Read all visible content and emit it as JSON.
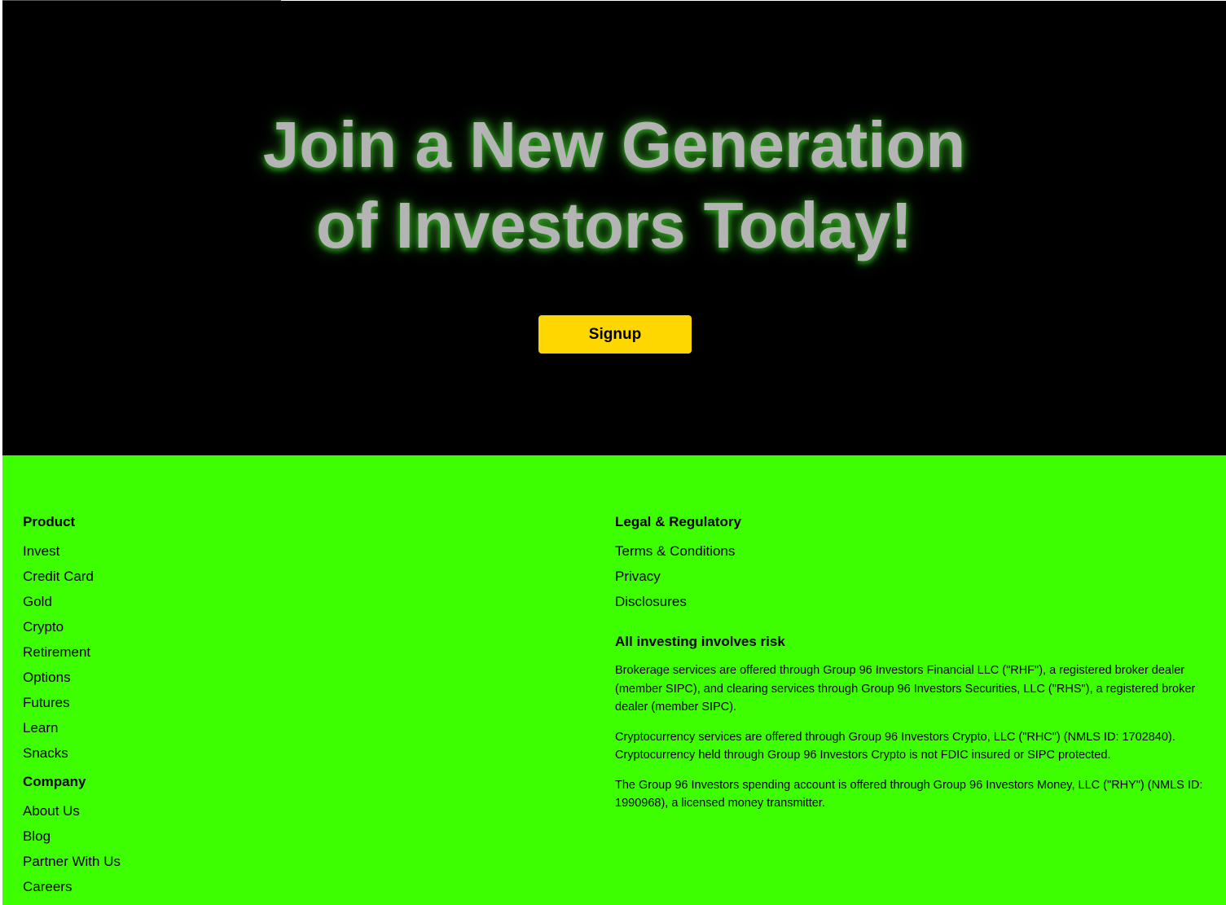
{
  "hero": {
    "title_line1": "Join a New Generation",
    "title_line2": "of Investors Today!",
    "signup_label": "Signup"
  },
  "colors": {
    "hero_background": "#000000",
    "footer_background": "#3dff00",
    "button_background": "#ffd700",
    "title_color": "#b4b4b4"
  },
  "footer": {
    "product": {
      "heading": "Product",
      "links": [
        "Invest",
        "Credit Card",
        "Gold",
        "Crypto",
        "Retirement",
        "Options",
        "Futures",
        "Learn",
        "Snacks"
      ]
    },
    "company": {
      "heading": "Company",
      "links": [
        "About Us",
        "Blog",
        "Partner With Us",
        "Careers"
      ]
    },
    "legal": {
      "heading": "Legal & Regulatory",
      "links": [
        "Terms & Conditions",
        "Privacy",
        "Disclosures"
      ]
    },
    "risk": {
      "heading": "All investing involves risk",
      "paragraphs": [
        "Brokerage services are offered through Group 96 Investors Financial LLC (\"RHF\"), a registered broker dealer (member SIPC), and clearing services through Group 96 Investors Securities, LLC (\"RHS\"), a registered broker dealer (member SIPC).",
        "Cryptocurrency services are offered through Group 96 Investors Crypto, LLC (\"RHC\") (NMLS ID: 1702840). Cryptocurrency held through Group 96 Investors Crypto is not FDIC insured or SIPC protected.",
        "The Group 96 Investors spending account is offered through Group 96 Investors Money, LLC (\"RHY\") (NMLS ID: 1990968), a licensed money transmitter."
      ]
    }
  }
}
